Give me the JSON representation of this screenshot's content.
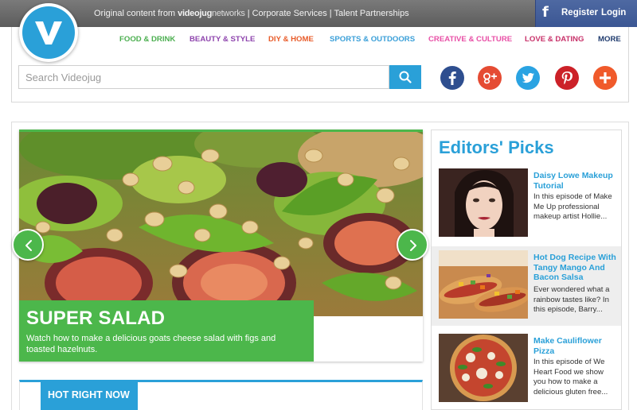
{
  "topbar": {
    "original_content": "Original content from",
    "brand_bold": "videojug",
    "brand_light": "networks",
    "links": "| Corporate Services | Talent Partnerships",
    "register": "Register",
    "login": "Login",
    "fb_glyph": "f"
  },
  "nav": {
    "items": [
      {
        "label": "FOOD & DRINK",
        "color": "#4caf50"
      },
      {
        "label": "BEAUTY & STYLE",
        "color": "#8e44ad"
      },
      {
        "label": "DIY & HOME",
        "color": "#e85c2a"
      },
      {
        "label": "SPORTS & OUTDOORS",
        "color": "#3a9fd8"
      },
      {
        "label": "CREATIVE & CULTURE",
        "color": "#e84fa6"
      },
      {
        "label": "LOVE & DATING",
        "color": "#c8326a"
      },
      {
        "label": "MORE",
        "color": "#1f3b6e"
      }
    ]
  },
  "search": {
    "placeholder": "Search Videojug"
  },
  "social": [
    {
      "name": "facebook-icon",
      "color": "#2e4e8f"
    },
    {
      "name": "google-plus-icon",
      "color": "#e54b33"
    },
    {
      "name": "twitter-icon",
      "color": "#2aa3e2"
    },
    {
      "name": "pinterest-icon",
      "color": "#cc2128"
    },
    {
      "name": "share-plus-icon",
      "color": "#f05a2b"
    }
  ],
  "hero": {
    "title": "SUPER SALAD",
    "description": "Watch how to make a delicious goats cheese salad with figs and toasted hazelnuts."
  },
  "hot": {
    "label": "HOT RIGHT NOW"
  },
  "picks": {
    "title": "Editors' Picks",
    "items": [
      {
        "title": "Daisy Lowe Makeup Tutorial",
        "desc": "In this episode of Make Me Up professional makeup artist Hollie..."
      },
      {
        "title": "Hot Dog Recipe With Tangy Mango And Bacon Salsa",
        "desc": "Ever wondered what a rainbow tastes like? In this episode, Barry..."
      },
      {
        "title": "Make Cauliflower Pizza",
        "desc": "In this episode of We Heart Food we show you how to make a delicious gluten free..."
      }
    ]
  },
  "colors": {
    "accent": "#2aa0d8",
    "green": "#4cb74b"
  }
}
